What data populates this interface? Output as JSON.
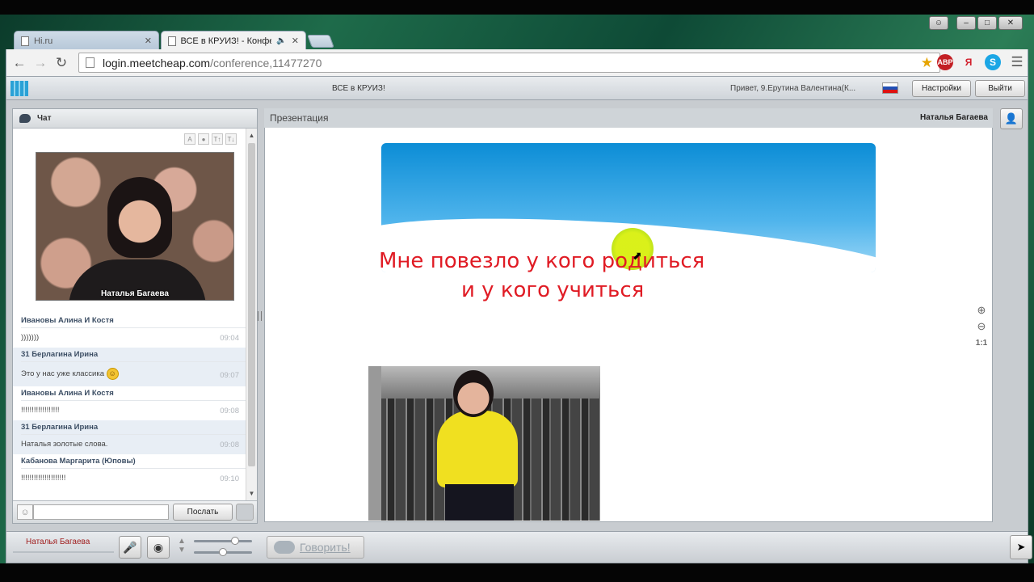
{
  "browser": {
    "tabs": [
      {
        "title": "Hi.ru",
        "active": false
      },
      {
        "title": "ВСЕ в КРУИЗ! - Конфе",
        "active": true
      }
    ],
    "url_host": "login.meetcheap.com",
    "url_path": "/conference,11477270",
    "extensions": [
      "ABP",
      "Я",
      "S"
    ]
  },
  "app": {
    "title": "ВСЕ в КРУИЗ!",
    "greeting": "Привет, 9.Ерутина Валентина(К...",
    "settings_label": "Настройки",
    "logout_label": "Выйти"
  },
  "chat": {
    "header": "Чат",
    "video_label": "Наталья Багаева",
    "messages": [
      {
        "author": "Ивановы Алина И Костя",
        "text": ")))))))",
        "time": "09:04"
      },
      {
        "author": "31 Берлагина Ирина",
        "text": "Это у нас уже классика",
        "time": "09:07",
        "emoji": true
      },
      {
        "author": "Ивановы Алина И Костя",
        "text": "!!!!!!!!!!!!!!!!!!",
        "time": "09:08"
      },
      {
        "author": "31 Берлагина Ирина",
        "text": "Наталья золотые слова.",
        "time": "09:08"
      },
      {
        "author": "Кабанова Маргарита (Юповы)",
        "text": "!!!!!!!!!!!!!!!!!!!!!",
        "time": "09:10"
      }
    ],
    "send_label": "Послать"
  },
  "presentation": {
    "header": "Презентация",
    "presenter": "Наталья Багаева",
    "slide_line1": "Мне повезло у кого родиться",
    "slide_line2": "и у кого учиться",
    "zoom_reset": "1:1"
  },
  "bottom": {
    "user_name": "Наталья Багаева",
    "speak_label": "Говорить!"
  }
}
